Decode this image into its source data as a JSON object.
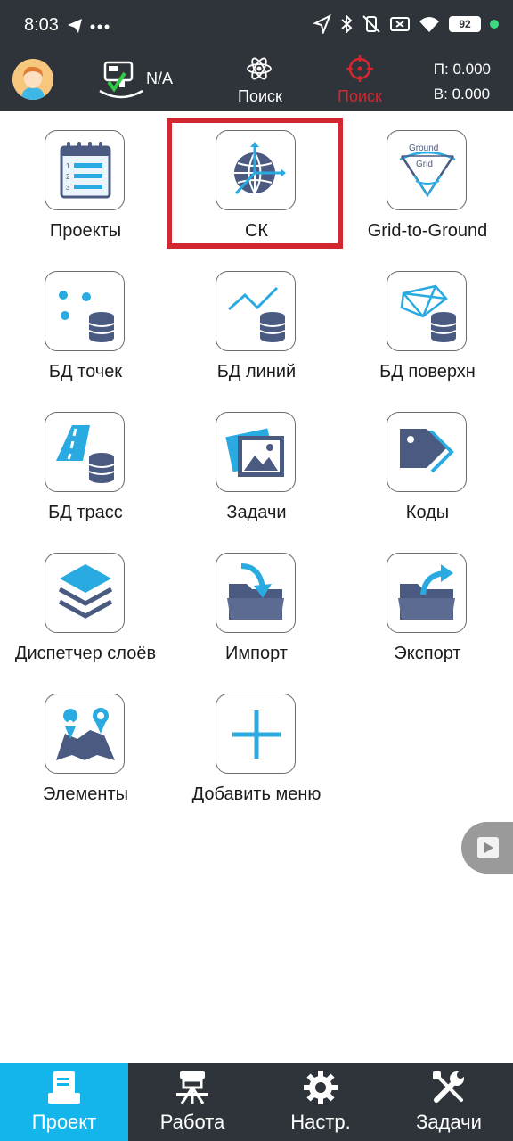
{
  "status_bar": {
    "time": "8:03",
    "battery": "92"
  },
  "toolbar": {
    "device_status": "N/A",
    "search_label": "Поиск",
    "search_alt_label": "Поиск",
    "coord_p": "П: 0.000",
    "coord_b": "В: 0.000"
  },
  "menu": {
    "items": [
      {
        "label": "Проекты",
        "icon": "projects-icon"
      },
      {
        "label": "СК",
        "icon": "coordinate-system-icon"
      },
      {
        "label": "Grid-to-Ground",
        "icon": "grid-to-ground-icon",
        "icon_text_top": "Ground",
        "icon_text_bottom": "Grid"
      },
      {
        "label": "БД точек",
        "icon": "points-db-icon"
      },
      {
        "label": "БД линий",
        "icon": "lines-db-icon"
      },
      {
        "label": "БД поверхн",
        "icon": "surface-db-icon"
      },
      {
        "label": "БД трасс",
        "icon": "routes-db-icon"
      },
      {
        "label": "Задачи",
        "icon": "tasks-image-icon"
      },
      {
        "label": "Коды",
        "icon": "codes-tag-icon"
      },
      {
        "label": "Диспетчер слоёв",
        "icon": "layers-icon"
      },
      {
        "label": "Импорт",
        "icon": "import-folder-icon"
      },
      {
        "label": "Экспорт",
        "icon": "export-folder-icon"
      },
      {
        "label": "Элементы",
        "icon": "elements-map-icon"
      },
      {
        "label": "Добавить меню",
        "icon": "add-icon"
      }
    ]
  },
  "bottom_nav": {
    "items": [
      {
        "label": "Проект",
        "icon": "project-icon",
        "active": true
      },
      {
        "label": "Работа",
        "icon": "survey-icon",
        "active": false
      },
      {
        "label": "Настр.",
        "icon": "gear-icon",
        "active": false
      },
      {
        "label": "Задачи",
        "icon": "tools-icon",
        "active": false
      }
    ]
  },
  "colors": {
    "bar_bg": "#2f343a",
    "accent_blue": "#13b5ea",
    "icon_navy": "#4a5a80",
    "highlight_red": "#d22630"
  }
}
